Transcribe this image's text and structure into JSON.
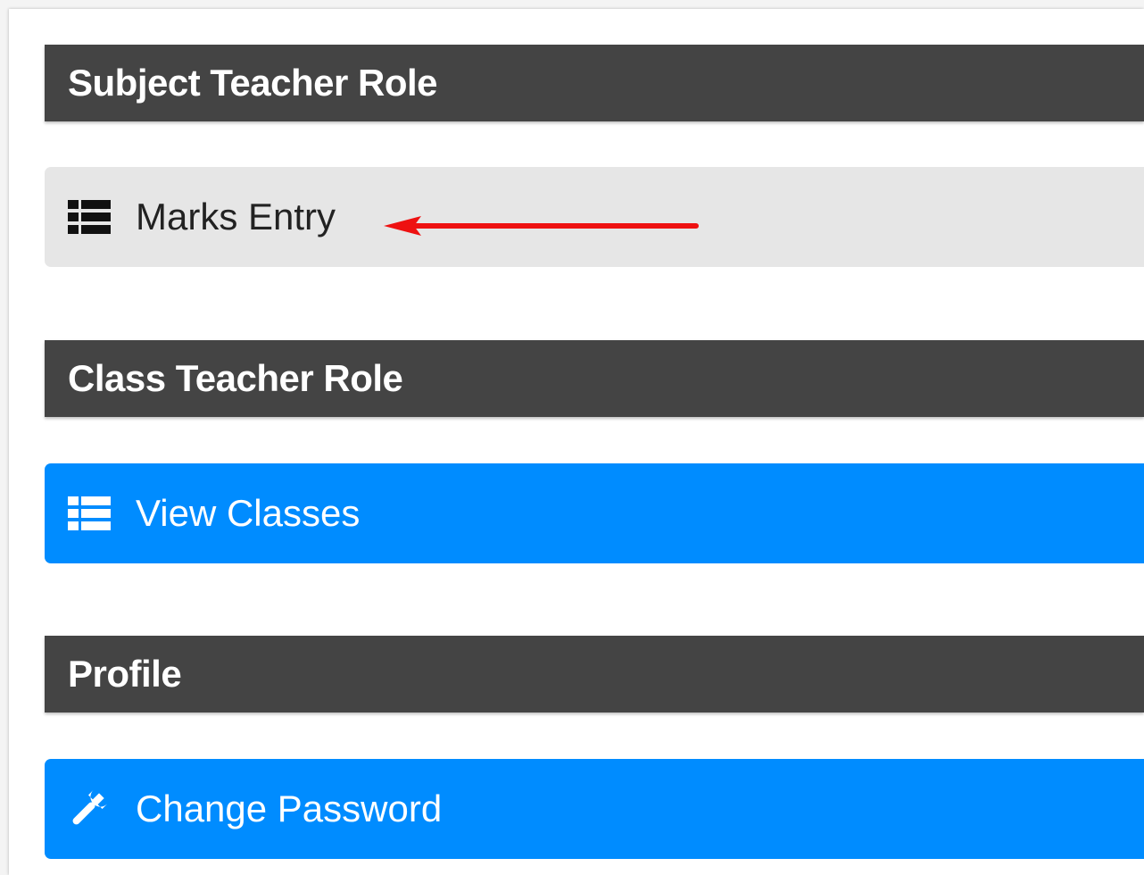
{
  "sections": {
    "subject_teacher": {
      "title": "Subject Teacher Role",
      "item": {
        "label": "Marks Entry",
        "icon": "list-icon"
      }
    },
    "class_teacher": {
      "title": "Class Teacher Role",
      "item": {
        "label": "View Classes",
        "icon": "list-icon"
      }
    },
    "profile": {
      "title": "Profile",
      "item": {
        "label": "Change Password",
        "icon": "wrench-icon"
      }
    }
  },
  "colors": {
    "header_bg": "#444444",
    "primary_button": "#008cff",
    "light_button": "#e6e6e6",
    "annotation_arrow": "#ee1111"
  }
}
